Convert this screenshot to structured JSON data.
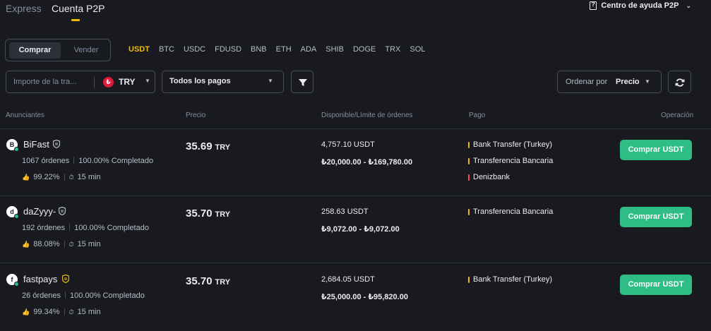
{
  "nav": {
    "tabs": [
      "Express",
      "Cuenta P2P"
    ],
    "active_tab": "Cuenta P2P",
    "help_label": "Centro de ayuda P2P"
  },
  "trade_toggle": {
    "buy": "Comprar",
    "sell": "Vender",
    "active": "Comprar"
  },
  "coins": [
    "USDT",
    "BTC",
    "USDC",
    "FDUSD",
    "BNB",
    "ETH",
    "ADA",
    "SHIB",
    "DOGE",
    "TRX",
    "SOL"
  ],
  "active_coin": "USDT",
  "filters": {
    "amount_placeholder": "Importe de la tra...",
    "fiat": "TRY",
    "fiat_symbol": "₺",
    "payments": "Todos los pagos",
    "sort_label": "Ordenar por",
    "sort_value": "Precio"
  },
  "columns": [
    "Anunciantes",
    "Precio",
    "Disponible/Límite de órdenes",
    "Pago",
    "Operación"
  ],
  "colors": {
    "accent": "#f0b90b",
    "buy_green": "#2ebd85",
    "bg": "#181a20",
    "bank_bar": "#f0b90b",
    "denizbank_bar": "#f6465d"
  },
  "ads": [
    {
      "initial": "B",
      "name": "BiFast",
      "badge_color": "#b7bdc6",
      "orders": "1067 órdenes",
      "completion": "100.00% Completado",
      "rating": "99.22%",
      "time": "15 min",
      "price": "35.69",
      "price_unit": "TRY",
      "available": "4,757.10 USDT",
      "limit": "₺20,000.00 - ₺169,780.00",
      "payments": [
        {
          "name": "Bank Transfer (Turkey)",
          "color": "#f0b90b"
        },
        {
          "name": "Transferencia Bancaria",
          "color": "#f0b90b"
        },
        {
          "name": "Denizbank",
          "color": "#f6465d"
        }
      ],
      "button": "Comprar USDT"
    },
    {
      "initial": "d",
      "name": "daZyyy-",
      "badge_color": "#b7bdc6",
      "orders": "192 órdenes",
      "completion": "100.00% Completado",
      "rating": "88.08%",
      "time": "15 min",
      "price": "35.70",
      "price_unit": "TRY",
      "available": "258.63 USDT",
      "limit": "₺9,072.00 - ₺9,072.00",
      "payments": [
        {
          "name": "Transferencia Bancaria",
          "color": "#f0b90b"
        }
      ],
      "button": "Comprar USDT"
    },
    {
      "initial": "f",
      "name": "fastpays",
      "badge_color": "#f0b90b",
      "orders": "26 órdenes",
      "completion": "100.00% Completado",
      "rating": "99.34%",
      "time": "15 min",
      "price": "35.70",
      "price_unit": "TRY",
      "available": "2,684.05 USDT",
      "limit": "₺25,000.00 - ₺95,820.00",
      "payments": [
        {
          "name": "Bank Transfer (Turkey)",
          "color": "#f0b90b"
        }
      ],
      "button": "Comprar USDT"
    }
  ]
}
